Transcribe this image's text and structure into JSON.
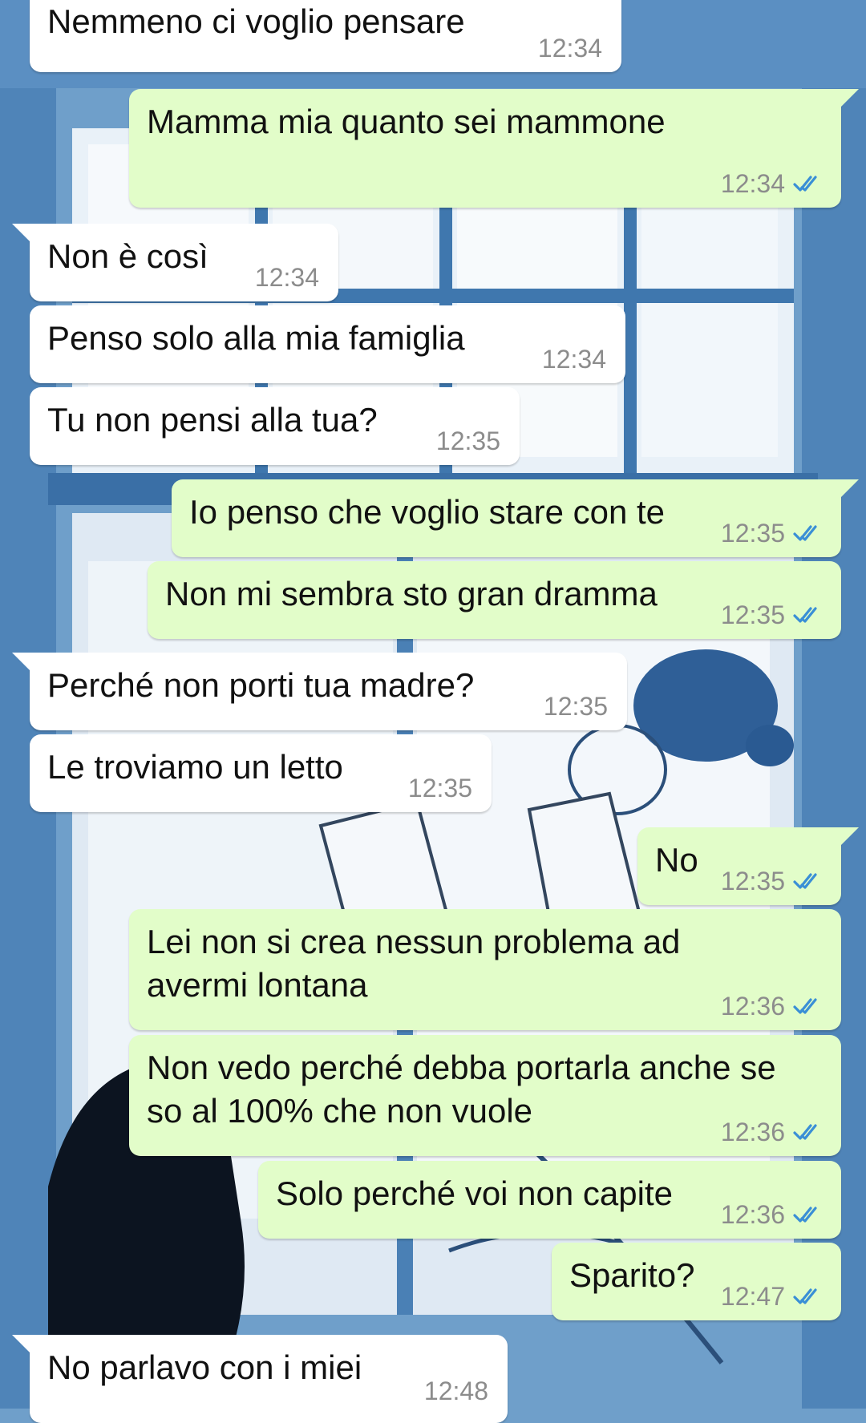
{
  "theme": {
    "incoming_bubble": "#ffffff",
    "outgoing_bubble": "#e2fdc9",
    "read_tick_color": "#3a8fd6",
    "timestamp_color": "#8c8c8c",
    "wallpaper_base": "#6f9fca"
  },
  "chat": {
    "messages": [
      {
        "direction": "in",
        "text": "Nemmeno ci voglio pensare",
        "time": "12:34",
        "status": ""
      },
      {
        "direction": "out",
        "text": "Mamma mia quanto sei mammone",
        "time": "12:34",
        "status": "read"
      },
      {
        "direction": "in",
        "text": "Non è così",
        "time": "12:34",
        "status": ""
      },
      {
        "direction": "in",
        "text": "Penso solo alla mia famiglia",
        "time": "12:34",
        "status": ""
      },
      {
        "direction": "in",
        "text": "Tu non pensi alla tua?",
        "time": "12:35",
        "status": ""
      },
      {
        "direction": "out",
        "text": "Io penso che voglio stare con te",
        "time": "12:35",
        "status": "read"
      },
      {
        "direction": "out",
        "text": "Non mi sembra sto gran dramma",
        "time": "12:35",
        "status": "read"
      },
      {
        "direction": "in",
        "text": "Perché non porti tua madre?",
        "time": "12:35",
        "status": ""
      },
      {
        "direction": "in",
        "text": "Le troviamo un letto",
        "time": "12:35",
        "status": ""
      },
      {
        "direction": "out",
        "text": "No",
        "time": "12:35",
        "status": "read"
      },
      {
        "direction": "out",
        "text": "Lei non si crea nessun problema ad\navermi lontana",
        "time": "12:36",
        "status": "read"
      },
      {
        "direction": "out",
        "text": "Non vedo perché debba portarla anche se\nso al 100% che non vuole",
        "time": "12:36",
        "status": "read"
      },
      {
        "direction": "out",
        "text": "Solo perché voi non capite",
        "time": "12:36",
        "status": "read"
      },
      {
        "direction": "out",
        "text": "Sparito?",
        "time": "12:47",
        "status": "read"
      },
      {
        "direction": "in",
        "text": "No parlavo con i miei",
        "time": "12:48",
        "status": ""
      }
    ]
  }
}
